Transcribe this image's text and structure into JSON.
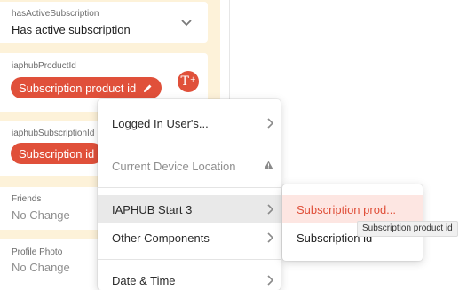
{
  "fields": [
    {
      "label": "hasActiveSubscription",
      "value": "Has active subscription",
      "icon": "chevron-down-icon"
    },
    {
      "label": "iaphubProductId",
      "pill": "Subscription product id",
      "pill_icon": "pencil-icon",
      "action_icon": "text-insert-icon",
      "action_glyph": "T",
      "action_sup": "+"
    },
    {
      "label": "iaphubSubscriptionId",
      "pill": "Subscription id"
    },
    {
      "label": "Friends",
      "value": "No Change",
      "icon": "chevron-down-icon"
    },
    {
      "label": "Profile Photo",
      "value": "No Change",
      "icon": "chevron-down-icon"
    }
  ],
  "menu": {
    "items": [
      {
        "label": "Logged In User's...",
        "has_submenu": true
      },
      {
        "label": "Current Device Location",
        "disabled": true,
        "icon": "warning-icon"
      },
      {
        "label": "IAPHUB Start 3",
        "has_submenu": true,
        "active": true
      },
      {
        "label": "Other Components",
        "has_submenu": true
      },
      {
        "label": "Date & Time",
        "has_submenu": true
      }
    ]
  },
  "submenu": {
    "items": [
      {
        "label": "Subscription prod...",
        "hover": true
      },
      {
        "label": "Subscription id"
      }
    ]
  },
  "tooltip": "Subscription product id",
  "colors": {
    "accent": "#e0503a",
    "panel_bg": "#fdf2d9",
    "hover_bg": "#fde6e2",
    "active_bg": "#e9e9e9"
  }
}
